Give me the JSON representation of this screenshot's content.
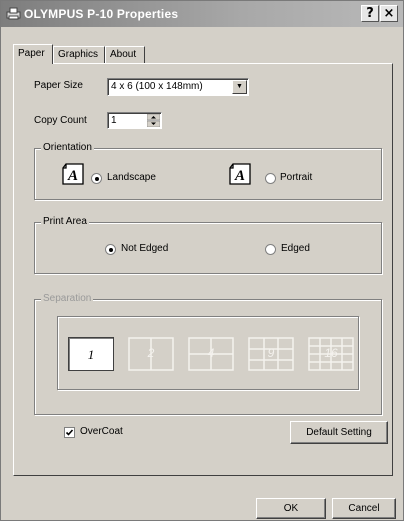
{
  "window": {
    "title": "OLYMPUS P-10 Properties",
    "help_button": "?",
    "close_button": "×"
  },
  "tabs": [
    {
      "label": "Paper",
      "active": true
    },
    {
      "label": "Graphics",
      "active": false
    },
    {
      "label": "About",
      "active": false
    }
  ],
  "paper": {
    "paper_size_label": "Paper Size",
    "paper_size_value": "4 x 6 (100 x 148mm)",
    "copy_count_label": "Copy Count",
    "copy_count_value": "1"
  },
  "orientation": {
    "title": "Orientation",
    "landscape_label": "Landscape",
    "portrait_label": "Portrait",
    "selected": "Landscape",
    "icon_letter": "A"
  },
  "print_area": {
    "title": "Print Area",
    "not_edged_label": "Not Edged",
    "edged_label": "Edged",
    "selected": "Not Edged"
  },
  "separation": {
    "title": "Separation",
    "enabled": false,
    "options": [
      "1",
      "2",
      "4",
      "9",
      "16"
    ],
    "selected": "1"
  },
  "overcoat": {
    "label": "OverCoat",
    "checked": true
  },
  "buttons": {
    "default_setting": "Default Setting",
    "ok": "OK",
    "cancel": "Cancel"
  },
  "colors": {
    "dialog_bg": "#d4d0c8",
    "titlebar_start": "#7d7d7d",
    "titlebar_end": "#b9b9b9",
    "disabled_text": "#9a9a9a"
  }
}
